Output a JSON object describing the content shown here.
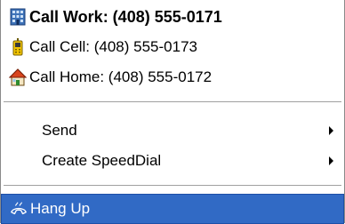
{
  "menu": {
    "items": [
      {
        "label": "Call Work: (408) 555-0171",
        "icon": "office-building-icon"
      },
      {
        "label": "Call Cell: (408) 555-0173",
        "icon": "mobile-phone-icon"
      },
      {
        "label": "Call Home: (408) 555-0172",
        "icon": "house-icon"
      }
    ],
    "submenus": [
      {
        "label": "Send"
      },
      {
        "label": "Create SpeedDial"
      }
    ],
    "hang_up": {
      "label": "Hang Up",
      "icon": "hang-up-phone-icon"
    }
  },
  "colors": {
    "selection_background": "#316ac5",
    "selection_text": "#ffffff"
  }
}
